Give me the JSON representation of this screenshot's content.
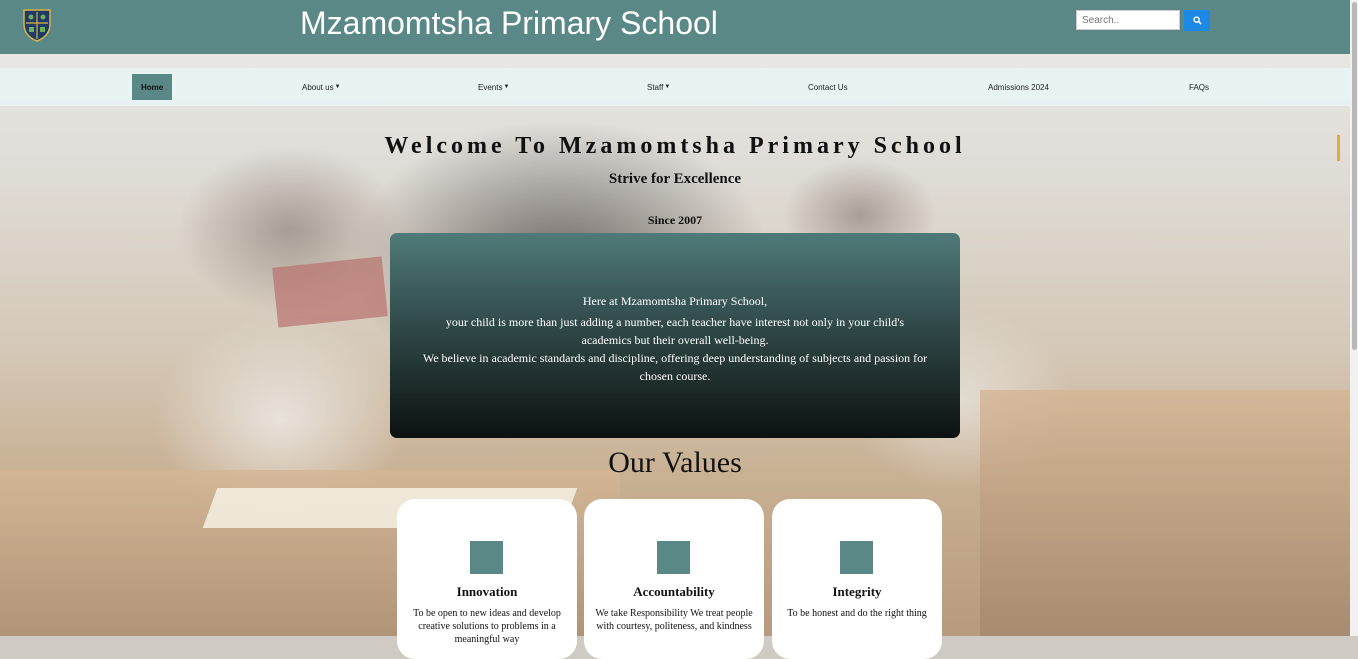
{
  "header": {
    "title": "Mzamomtsha Primary School",
    "search_placeholder": "Search..",
    "colors": {
      "header_bg": "#598887",
      "search_button": "#1e88e5"
    }
  },
  "nav": {
    "items": [
      {
        "label": "Home",
        "active": true
      },
      {
        "label": "About us",
        "dropdown": true
      },
      {
        "label": "Events",
        "dropdown": true
      },
      {
        "label": "Staff",
        "dropdown": true
      },
      {
        "label": "Contact Us"
      },
      {
        "label": "Admissions 2024"
      },
      {
        "label": "FAQs"
      }
    ]
  },
  "hero": {
    "welcome": "Welcome To Mzamomtsha Primary School",
    "tagline": "Strive for Excellence",
    "since": "Since 2007"
  },
  "intro": {
    "line1": "Here at Mzamomtsha Primary School,",
    "line2": "your child is more than just adding a number, each teacher have interest not only in your child's academics but their overall well-being.",
    "line3": "We believe in academic standards and discipline, offering deep understanding of subjects and passion for chosen course."
  },
  "values": {
    "heading": "Our Values",
    "cards": [
      {
        "title": "Innovation",
        "text": "To be open to new ideas and develop creative solutions to problems in a meaningful way"
      },
      {
        "title": "Accountability",
        "text": "We take Responsibility We treat people with courtesy, politeness, and kindness"
      },
      {
        "title": "Integrity",
        "text": "To be honest and do the right thing"
      }
    ]
  }
}
